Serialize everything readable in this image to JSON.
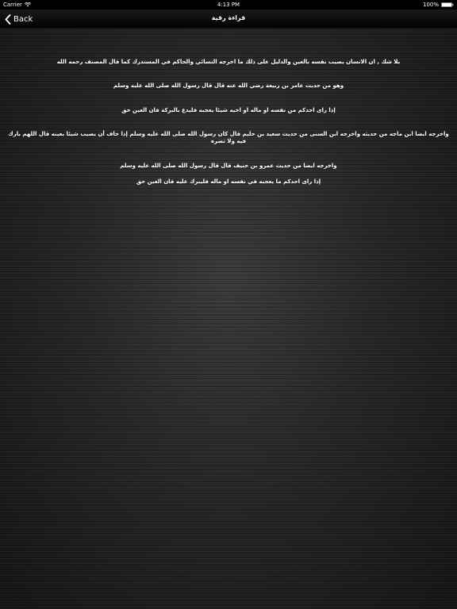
{
  "status_bar": {
    "carrier": "Carrier",
    "time": "4:13 PM",
    "battery": "100%",
    "wifi_icon": "wifi-icon",
    "battery_icon": "battery-full-icon"
  },
  "nav": {
    "back_label": "Back",
    "back_icon": "chevron-left-icon",
    "title": "قراءة رقية"
  },
  "paragraphs": [
    "بلا شك , ان الانسان يصيب نفسه بالعين والدليل على ذلك ما اخرجه النسائي والحاكم في المستدرك كما قال المصنف رحمه الله",
    "وهو من حديث عامر بن ربيعة رضي الله عنه قال قال رسول الله صلى الله عليه وسلم",
    "إذا راى احدكم من نفسه او ماله او اخيه شيئا يعجبه فليدع بالبركة فان العين حق",
    "واخرجه ايضا ابن ماجه من حديثه واخرجه ابن السنى من حديث سعيد بن حليم قال كان رسول الله صلى الله عليه وسلم إذا خاف أن يصيب شيئا بعينه قال اللهم بارك فيه ولا تضره",
    "واخرجه ايضا من حديث عمرو بن حنيف قال قال رسول الله صلى الله عليه وسلم",
    "إذا راى احدكم ما يعجبه في نفسه او ماله فليبرك عليه فان العين حق"
  ],
  "colors": {
    "text": "#ffffff",
    "nav_background": "#000000",
    "background": "#262626"
  }
}
